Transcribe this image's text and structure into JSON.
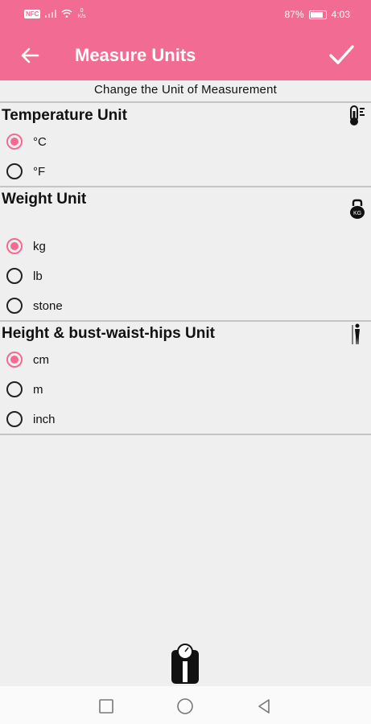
{
  "status_bar": {
    "badge": "NFC",
    "net_speed_value": "0",
    "net_speed_unit": "K/s",
    "battery_text": "87%",
    "battery_level": 0.87,
    "time": "4:03"
  },
  "app_bar": {
    "title": "Measure Units",
    "back_icon": "arrow-left-icon",
    "confirm_icon": "check-icon"
  },
  "subtitle": "Change the Unit of Measurement",
  "sections": {
    "temperature": {
      "title": "Temperature Unit",
      "icon": "thermometer-icon",
      "options": [
        "°C",
        "°F"
      ],
      "selected": "°C"
    },
    "weight": {
      "title": "Weight Unit",
      "icon": "kettlebell-icon",
      "options": [
        "kg",
        "lb",
        "stone"
      ],
      "selected": "kg"
    },
    "height": {
      "title": "Height & bust-waist-hips Unit",
      "icon": "person-icon",
      "options": [
        "cm",
        "m",
        "inch"
      ],
      "selected": "cm"
    }
  },
  "footer_icon": "bathroom-scale-icon",
  "nav_bar": {
    "recent_icon": "square-icon",
    "home_icon": "circle-icon",
    "back_icon": "triangle-back-icon"
  },
  "colors": {
    "accent": "#f26b92",
    "background": "#efefef",
    "divider": "#c4c4c4"
  }
}
